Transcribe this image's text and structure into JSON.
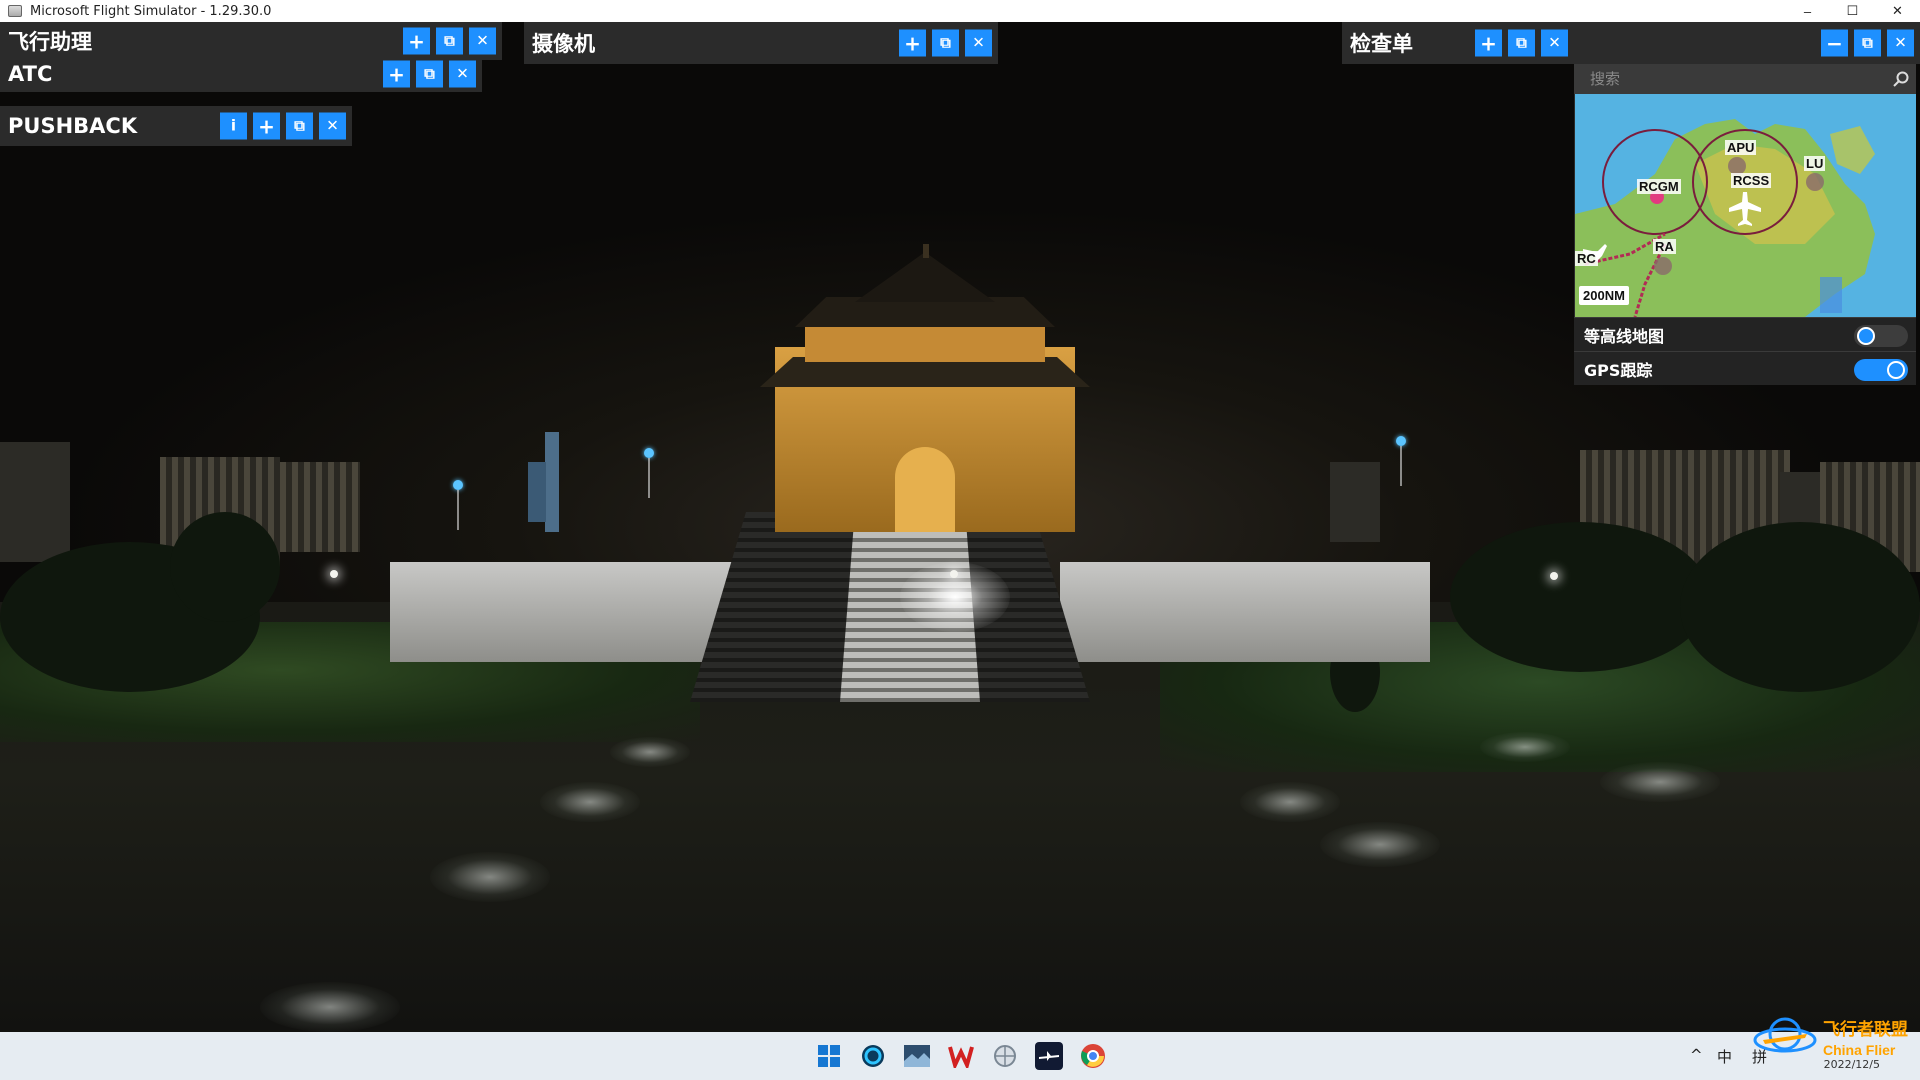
{
  "window": {
    "title": "Microsoft Flight Simulator - 1.29.30.0",
    "controls": {
      "minimize": "–",
      "maximize": "☐",
      "close": "✕"
    }
  },
  "panels": {
    "flight_assist": {
      "title": "飞行助理"
    },
    "camera": {
      "title": "摄像机"
    },
    "checklist": {
      "title": "检查单"
    },
    "atc": {
      "title": "ATC"
    },
    "pushback": {
      "title": "PUSHBACK"
    }
  },
  "panel_buttons": {
    "info": "i",
    "add": "+",
    "undock": "⧉",
    "close": "✕",
    "minimize": "−"
  },
  "map_panel": {
    "search_placeholder": "搜索",
    "labels": {
      "rcgm": "RCGM",
      "apu": "APU",
      "lu": "LU",
      "rcss": "RCSS",
      "ra": "RA",
      "rc": "RC"
    },
    "scale": "200NM",
    "toggles": [
      {
        "label": "等高线地图",
        "on": false
      },
      {
        "label": "GPS跟踪",
        "on": true
      }
    ]
  },
  "taskbar": {
    "tray": {
      "chevron": "^",
      "lang": "中",
      "ime": "拼"
    },
    "date": "2022/12/5"
  },
  "watermark": {
    "cn": "飞行者联盟",
    "en": "China Flier"
  },
  "colors": {
    "accent": "#1e90ff",
    "panel_bg": "#2b2b2b",
    "map_land": "#8bbf5a",
    "map_sea": "#55b3e2",
    "watermark": "#ffa300"
  }
}
